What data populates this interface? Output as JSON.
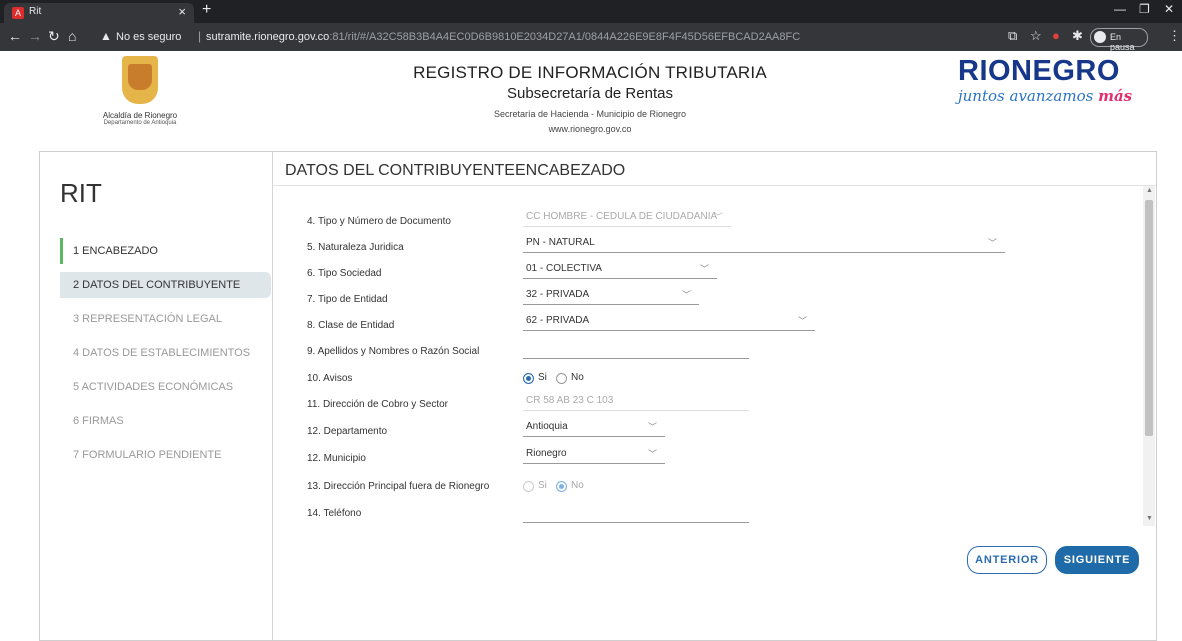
{
  "browser": {
    "tab_title": "Rit",
    "tab_favicon": "A",
    "url_warning": "No es seguro",
    "url_host": "sutramite.rionegro.gov.co",
    "url_rest": ":81/rit/#/A32C58B3B4A4EC0D6B9810E2034D27A1/0844A226E9E8F4F45D56EFBCAD2AA8FC",
    "profile_label": "En pausa"
  },
  "header": {
    "alcaldia_name": "Alcaldía de Rionegro",
    "alcaldia_sub": "Departamento de Antioquia",
    "title": "REGISTRO DE INFORMACIÓN TRIBUTARIA",
    "subtitle": "Subsecretaría de Rentas",
    "dept": "Secretaría de Hacienda - Municipio de Rionegro",
    "website": "www.rionegro.gov.co",
    "brand_main": "RIONEGRO",
    "brand_slogan_a": "juntos avanzamos ",
    "brand_slogan_b": "más"
  },
  "sidebar": {
    "title": "RIT",
    "steps": [
      {
        "label": "1 ENCABEZADO",
        "state": "done"
      },
      {
        "label": "2 DATOS DEL CONTRIBUYENTE",
        "state": "current"
      },
      {
        "label": "3 REPRESENTACIÓN LEGAL",
        "state": "pending"
      },
      {
        "label": "4 DATOS DE ESTABLECIMIENTOS",
        "state": "pending"
      },
      {
        "label": "5 ACTIVIDADES ECONÓMICAS",
        "state": "pending"
      },
      {
        "label": "6 FIRMAS",
        "state": "pending"
      },
      {
        "label": "7 FORMULARIO PENDIENTE",
        "state": "pending"
      }
    ]
  },
  "content": {
    "title": "DATOS DEL CONTRIBUYENTEENCABEZADO",
    "fields": {
      "tipo_documento": {
        "label": "4. Tipo y Número de Documento",
        "value": "CC HOMBRE - CEDULA DE CIUDADANIA"
      },
      "naturaleza": {
        "label": "5. Naturaleza Juridica",
        "value": "PN - NATURAL"
      },
      "tipo_sociedad": {
        "label": "6. Tipo Sociedad",
        "value": "01 - COLECTIVA"
      },
      "tipo_entidad": {
        "label": "7. Tipo de Entidad",
        "value": "32 - PRIVADA"
      },
      "clase_entidad": {
        "label": "8. Clase de Entidad",
        "value": "62 - PRIVADA"
      },
      "nombres": {
        "label": "9. Apellidos y Nombres o Razón Social",
        "value": ""
      },
      "avisos": {
        "label": "10. Avisos",
        "opt_yes": "Si",
        "opt_no": "No",
        "selected": "Si"
      },
      "direccion": {
        "label": "11. Dirección de Cobro y Sector",
        "placeholder": "CR 58 AB  23 C  103"
      },
      "departamento": {
        "label": "12. Departamento",
        "value": "Antioquia"
      },
      "municipio": {
        "label": "12. Municipio",
        "value": "Rionegro"
      },
      "dir_fuera": {
        "label": "13. Dirección Principal fuera de Rionegro",
        "opt_yes": "Si",
        "opt_no": "No",
        "selected": "No"
      },
      "telefono": {
        "label": "14. Teléfono",
        "value": ""
      }
    },
    "buttons": {
      "prev": "ANTERIOR",
      "next": "SIGUIENTE"
    }
  },
  "colors": {
    "primary": "#1f6aa8",
    "active_step_bar": "#5cb85c",
    "current_step_bg": "#dfe6ea"
  }
}
